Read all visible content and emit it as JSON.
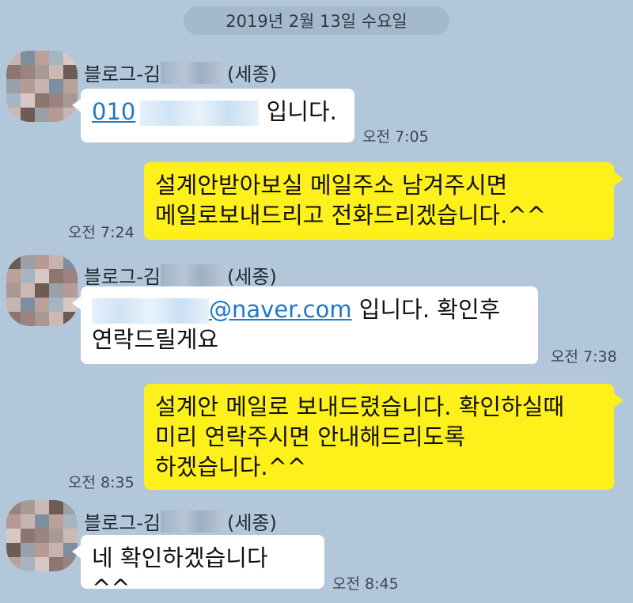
{
  "date_divider": "2019년 2월 13일 수요일",
  "sender": {
    "prefix": "블로그-김",
    "suffix": "(세종)"
  },
  "messages": [
    {
      "side": "in",
      "phone_prefix": "010",
      "text": " 입니다.",
      "time": "오전 7:05"
    },
    {
      "side": "out",
      "lines": [
        "설계안받아보실 메일주소 남겨주시면",
        "메일로보내드리고 전화드리겠습니다.^^"
      ],
      "time": "오전 7:24"
    },
    {
      "side": "in",
      "email_domain": "@naver.com",
      "line1_rest": " 입니다. 확인후",
      "line2": "연락드릴게요",
      "time": "오전 7:38"
    },
    {
      "side": "out",
      "lines": [
        "설계안 메일로 보내드렸습니다. 확인하실때",
        "미리 연락주시면 안내해드리도록",
        "하겠습니다.^^"
      ],
      "time": "오전 8:35"
    },
    {
      "side": "in",
      "text": "네 확인하겠습니다 ^^",
      "time": "오전 8:45"
    }
  ],
  "colors": {
    "background": "#b2c7da",
    "incoming_bubble": "#ffffff",
    "outgoing_bubble": "#fef01b",
    "link": "#2278c8"
  }
}
